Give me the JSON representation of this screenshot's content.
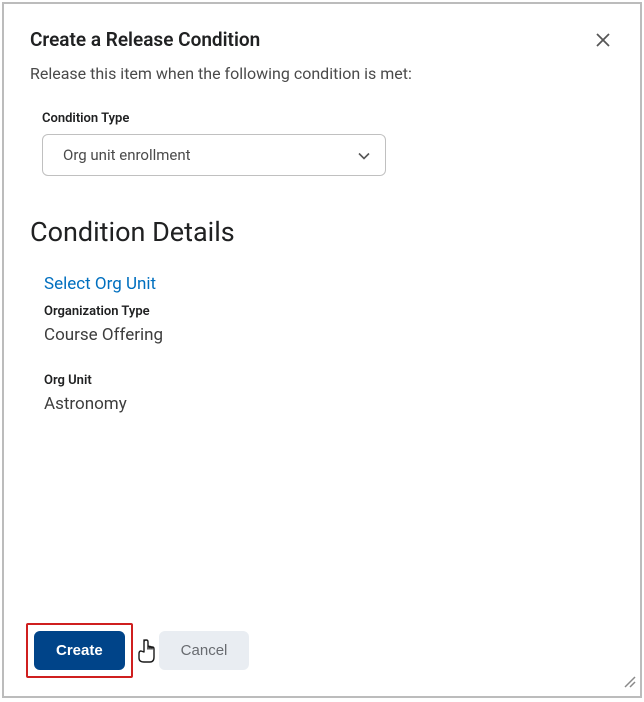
{
  "dialog": {
    "title": "Create a Release Condition",
    "subtitle": "Release this item when the following condition is met:"
  },
  "conditionType": {
    "label": "Condition Type",
    "value": "Org unit enrollment"
  },
  "section": {
    "heading": "Condition Details",
    "selectLink": "Select Org Unit",
    "orgTypeLabel": "Organization Type",
    "orgTypeValue": "Course Offering",
    "orgUnitLabel": "Org Unit",
    "orgUnitValue": "Astronomy"
  },
  "footer": {
    "create": "Create",
    "cancel": "Cancel"
  }
}
